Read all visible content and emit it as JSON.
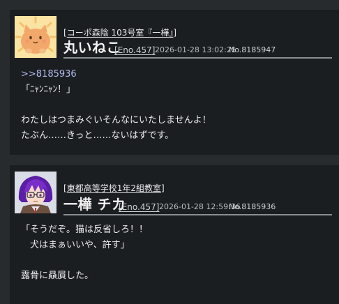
{
  "posts": [
    {
      "room_open": "[",
      "room_name": "コーポ森陰 103号室『一樺』",
      "room_close": "]",
      "character_name": "丸いねこ",
      "eno_text": "Eno.457",
      "timestamp": "2026-01-28 13:02:25",
      "post_number": "No.8185947",
      "avatar_desc": "round-cat-avatar",
      "lines": [
        ">>8185936",
        "「ﾆｬﾝﾆｬﾝ！」",
        "",
        "わたしはつまみぐいそんなにいたしませんよ！",
        "たぶん……きっと……ないはずです。"
      ]
    },
    {
      "room_open": "[",
      "room_name": "東都高等学校1年2組教室",
      "room_close": "]",
      "character_name": "一樺 チカ",
      "eno_text": "Eno.457",
      "timestamp": "2026-01-28 12:59:36",
      "post_number": "No.8185936",
      "avatar_desc": "purple-haired-student-avatar",
      "lines": [
        "「そうだぞ。猫は反省しろ！！",
        "　犬はまぁいいや、許す」",
        "",
        "露骨に贔屓した。"
      ]
    }
  ],
  "colors": {
    "page_bg": "#272b2d",
    "card_bg": "#1b1e21",
    "text": "#e6e6e6",
    "reply_link": "#b4bdf0",
    "divider": "#8a8f93",
    "cat_avatar_bg": "#fbe3a4",
    "cat_body": "#f2a86a",
    "student_hair": "#7a2ec8"
  }
}
